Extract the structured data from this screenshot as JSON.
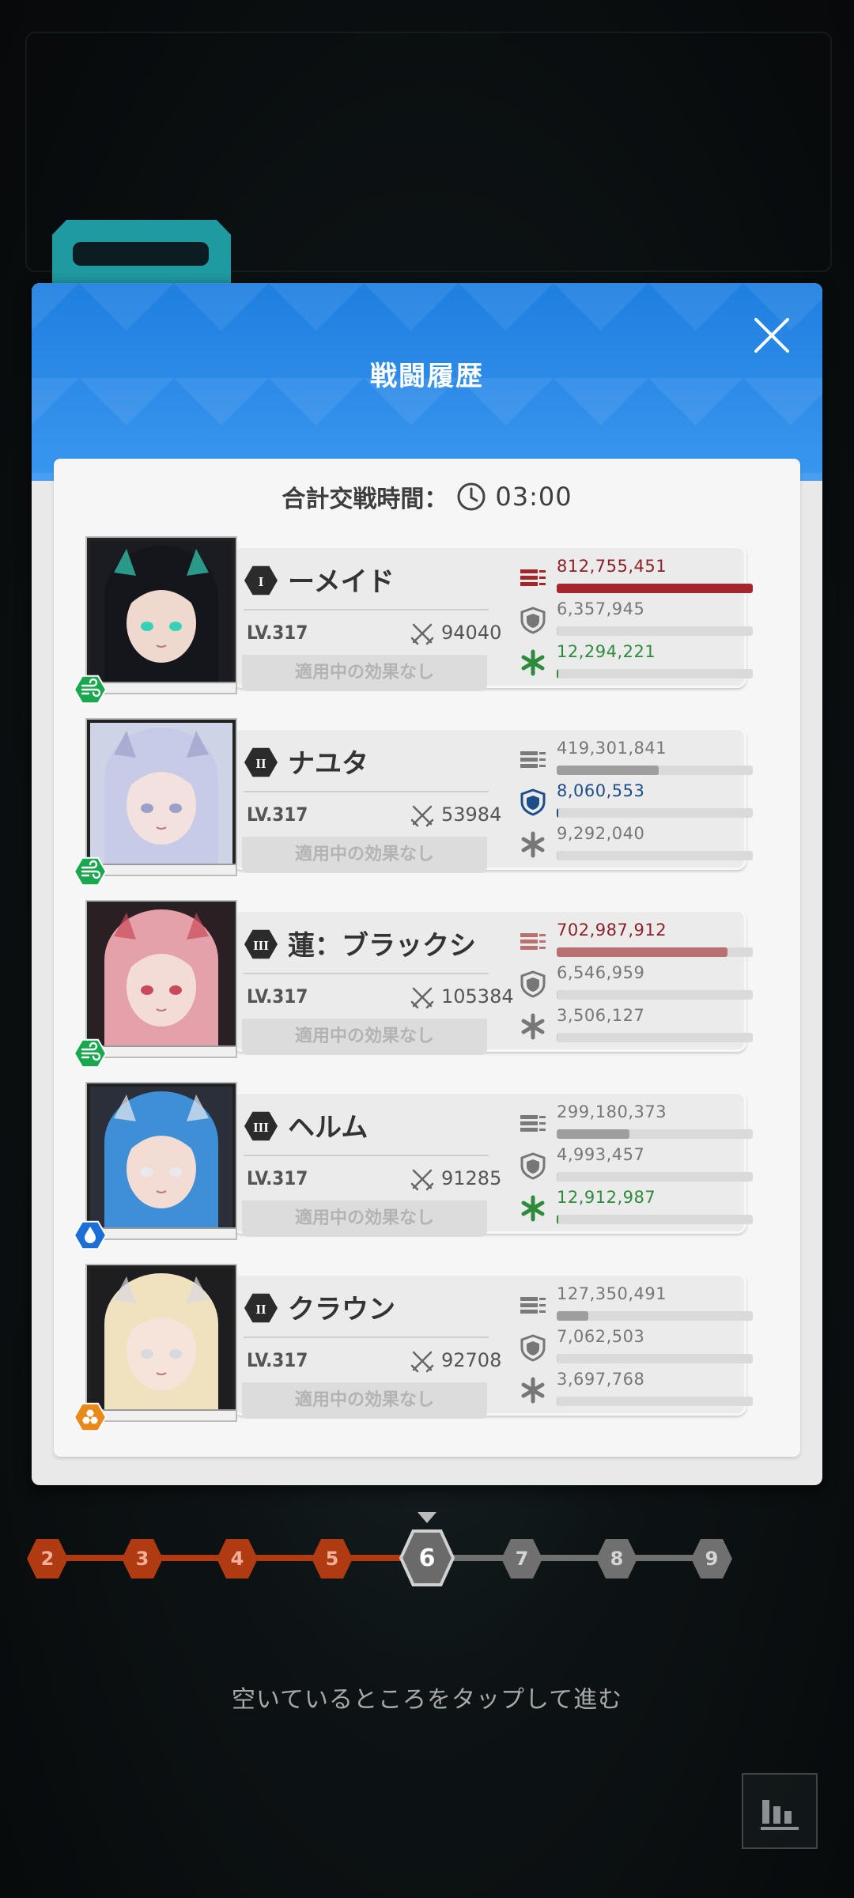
{
  "modal": {
    "title": "戦闘履歴",
    "total_label": "合計交戦時間：",
    "total_time": "03:00"
  },
  "characters": [
    {
      "rank": "I",
      "name": "ーメイド",
      "level": "LV.317",
      "power": "94040",
      "effect": "適用中の効果なし",
      "element": "wind",
      "element_color": "#1aa84f",
      "damage": "812,755,451",
      "damage_frac": 1.0,
      "damage_color": "#a3262d",
      "damage_text_color": "#8e2128",
      "defense": "6,357,945",
      "defense_frac": 0.0,
      "defense_text_color": "#777777",
      "heal": "12,294,221",
      "heal_frac": 0.01,
      "heal_text_color": "#2e8b3c"
    },
    {
      "rank": "II",
      "name": "ナユタ",
      "level": "LV.317",
      "power": "53984",
      "effect": "適用中の効果なし",
      "element": "wind",
      "element_color": "#1aa84f",
      "damage": "419,301,841",
      "damage_frac": 0.52,
      "damage_color": "#9e9e9e",
      "damage_text_color": "#777777",
      "defense": "8,060,553",
      "defense_frac": 0.01,
      "defense_text_color": "#1c4f8a",
      "heal": "9,292,040",
      "heal_frac": 0.0,
      "heal_text_color": "#777777"
    },
    {
      "rank": "III",
      "name": "蓮：ブラックシ",
      "level": "LV.317",
      "power": "105384",
      "effect": "適用中の効果なし",
      "element": "wind",
      "element_color": "#1aa84f",
      "damage": "702,987,912",
      "damage_frac": 0.87,
      "damage_color": "#b87070",
      "damage_text_color": "#8e2128",
      "defense": "6,546,959",
      "defense_frac": 0.0,
      "defense_text_color": "#777777",
      "heal": "3,506,127",
      "heal_frac": 0.0,
      "heal_text_color": "#777777"
    },
    {
      "rank": "III",
      "name": "ヘルム",
      "level": "LV.317",
      "power": "91285",
      "effect": "適用中の効果なし",
      "element": "water",
      "element_color": "#1d6fd6",
      "damage": "299,180,373",
      "damage_frac": 0.37,
      "damage_color": "#9e9e9e",
      "damage_text_color": "#777777",
      "defense": "4,993,457",
      "defense_frac": 0.0,
      "defense_text_color": "#777777",
      "heal": "12,912,987",
      "heal_frac": 0.01,
      "heal_text_color": "#2e8b3c"
    },
    {
      "rank": "II",
      "name": "クラウン",
      "level": "LV.317",
      "power": "92708",
      "effect": "適用中の効果なし",
      "element": "iron",
      "element_color": "#e8891a",
      "damage": "127,350,491",
      "damage_frac": 0.16,
      "damage_color": "#9e9e9e",
      "damage_text_color": "#777777",
      "defense": "7,062,503",
      "defense_frac": 0.0,
      "defense_text_color": "#777777",
      "heal": "3,697,768",
      "heal_frac": 0.0,
      "heal_text_color": "#777777"
    }
  ],
  "timeline": {
    "nodes": [
      "2",
      "3",
      "4",
      "5",
      "6",
      "7",
      "8",
      "9"
    ],
    "current": "6",
    "done_color": "#b03a12",
    "todo_color": "#707070"
  },
  "hint": "空いているところをタップして進む",
  "colors": {
    "header": "#2a8be6",
    "accent": "#1e9aa0"
  }
}
